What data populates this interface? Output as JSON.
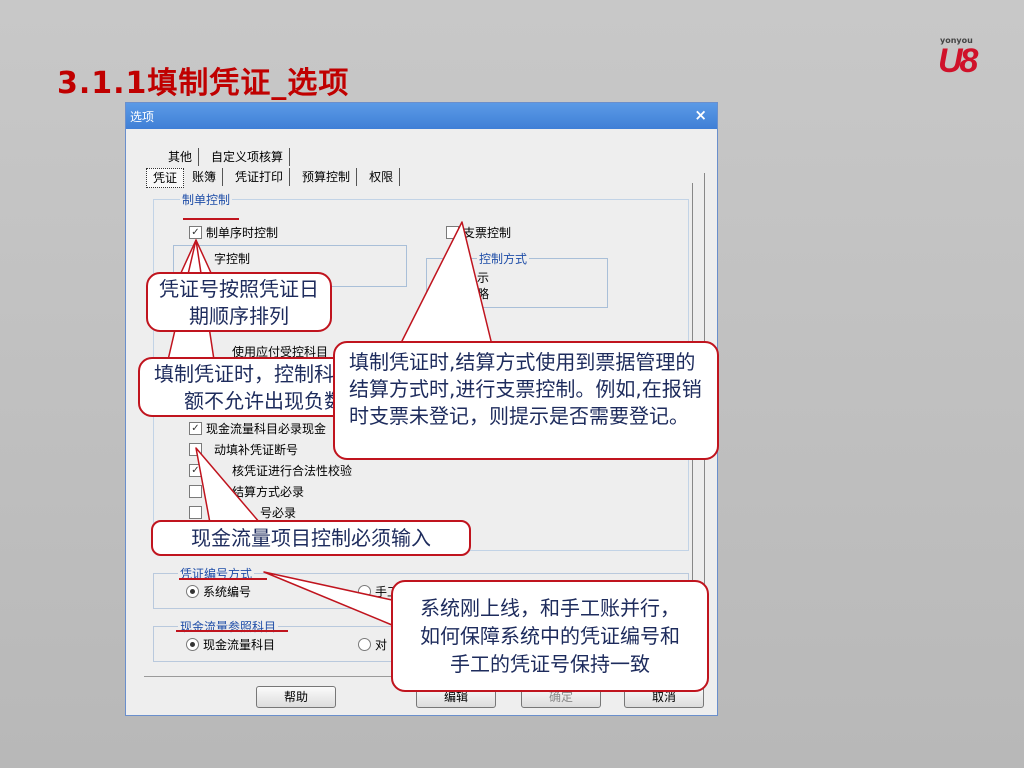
{
  "slide": {
    "title": "3.1.1填制凭证_选项"
  },
  "logo": {
    "brand": "yonyou",
    "mark": "U8",
    "color": "#d0122a"
  },
  "dialog": {
    "title": "选项",
    "close_glyph": "×",
    "tabs_row1": [
      "其他",
      "自定义项核算"
    ],
    "tabs_row2": [
      "凭证",
      "账簿",
      "凭证打印",
      "预算控制",
      "权限"
    ],
    "active_tab": "凭证",
    "group_zhidan": {
      "label": "制单控制"
    },
    "options": {
      "zhidan_order": {
        "label": "制单序时控制",
        "checked": true
      },
      "zhipiao": {
        "label": "支票控制",
        "checked": false
      },
      "chizi": {
        "label": "字控制"
      },
      "ziyuan_group": {
        "label": "控制方式"
      },
      "ziyuan_opt1": {
        "label": "示"
      },
      "ziyuan_opt2": {
        "label": "略"
      },
      "yingshou": {
        "label": "使用应付受控科目"
      },
      "xianjin": {
        "label": "现金流量科目必录现金",
        "checked": true
      },
      "zidong": {
        "label": "动填补凭证断号",
        "checked": false
      },
      "hefa": {
        "label": "核凭证进行合法性校验",
        "checked": true
      },
      "jiesuan": {
        "label": "结算方式必录",
        "checked": false
      },
      "piaohao": {
        "label": "号必录",
        "checked": false
      }
    },
    "group_bianhao": {
      "label": "凭证编号方式",
      "opt_system": "系统编号",
      "opt_manual": "手工"
    },
    "group_cankao": {
      "label": "现金流量参照科目",
      "opt_xianjin": "现金流量科目",
      "opt_dui": "对"
    },
    "buttons": {
      "help": "帮助",
      "edit": "编辑",
      "confirm": "确定",
      "cancel": "取消"
    }
  },
  "callouts": {
    "c1": "凭证号按照凭证日期顺序排列",
    "c2": "填制凭证时，控制科目余额不允许出现负数",
    "c3": "填制凭证时,结算方式使用到票据管理的结算方式时,进行支票控制。例如,在报销时支票未登记，则提示是否需要登记。",
    "c4": "现金流量项目控制必须输入",
    "c5": "系统刚上线，和手工账并行，如何保障系统中的凭证编号和手工的凭证号保持一致"
  },
  "colors": {
    "title_red": "#c00000",
    "callout_border": "#c0141e",
    "callout_text": "#1d2b5c",
    "titlebar": "#3f7fd6"
  }
}
